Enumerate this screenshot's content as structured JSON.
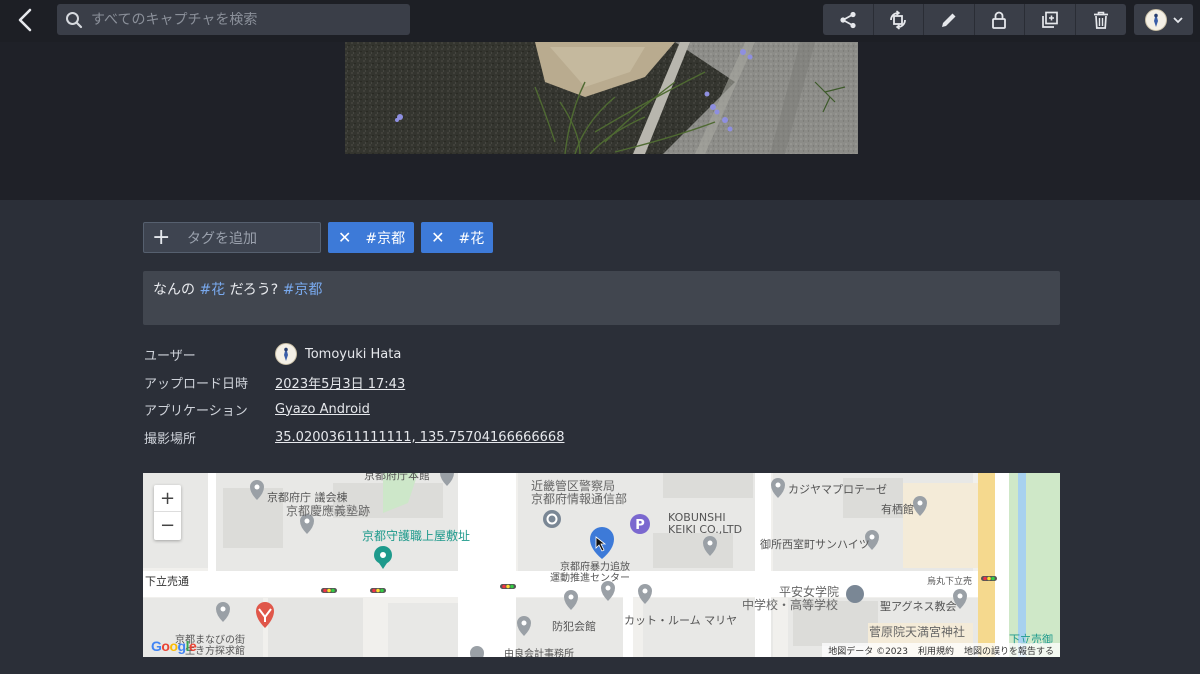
{
  "search": {
    "placeholder": "すべてのキャプチャを検索"
  },
  "toolbar": {
    "icons": [
      "share-icon",
      "rotate-icon",
      "pencil-icon",
      "lock-icon",
      "duplicate-icon",
      "trash-icon"
    ]
  },
  "tags": {
    "add_label": "タグを追加",
    "items": [
      "#京都",
      "#花"
    ]
  },
  "description": {
    "prefix": "なんの ",
    "tag1": "#花",
    "middle": " だろう? ",
    "tag2": "#京都"
  },
  "meta": {
    "user_label": "ユーザー",
    "user_value": "Tomoyuki Hata",
    "upload_label": "アップロード日時",
    "upload_value": "2023年5月3日 17:43",
    "app_label": "アプリケーション",
    "app_value": "Gyazo Android",
    "location_label": "撮影場所",
    "location_value": "35.02003611111111, 135.75704166666668"
  },
  "map": {
    "labels": {
      "l1": "京都府庁 議会棟",
      "l2": "京都慶應義塾跡",
      "l3": "京都守護職上屋敷址",
      "l4": "近畿管区警察局",
      "l5": "京都府情報通信部",
      "l6": "KOBUNSHI",
      "l7": "KEIKI CO.,LTD",
      "l8": "カジヤマプロテーゼ",
      "l9": "有栖館",
      "l10": "御所西室町サンハイツ",
      "l11": "京都府暴力追放",
      "l12": "運動推進センター",
      "l13": "下立売通",
      "l14": "平安女学院",
      "l15": "中学校・高等学校",
      "l16": "聖アグネス教会",
      "l17": "烏丸下立売",
      "l18": "防犯会館",
      "l19": "カット・ルーム マリヤ",
      "l20": "菅原院天満宮神社",
      "l21": "下立売御",
      "l22": "京都まなびの街",
      "l23": "生き方探求館",
      "l24": "由良会計事務所",
      "l25": "京都府庁本館"
    },
    "zoom_in": "+",
    "zoom_out": "−",
    "logo": "Google",
    "attrib_data": "地図データ ©2023",
    "attrib_terms": "利用規約",
    "attrib_report": "地図の誤りを報告する"
  }
}
